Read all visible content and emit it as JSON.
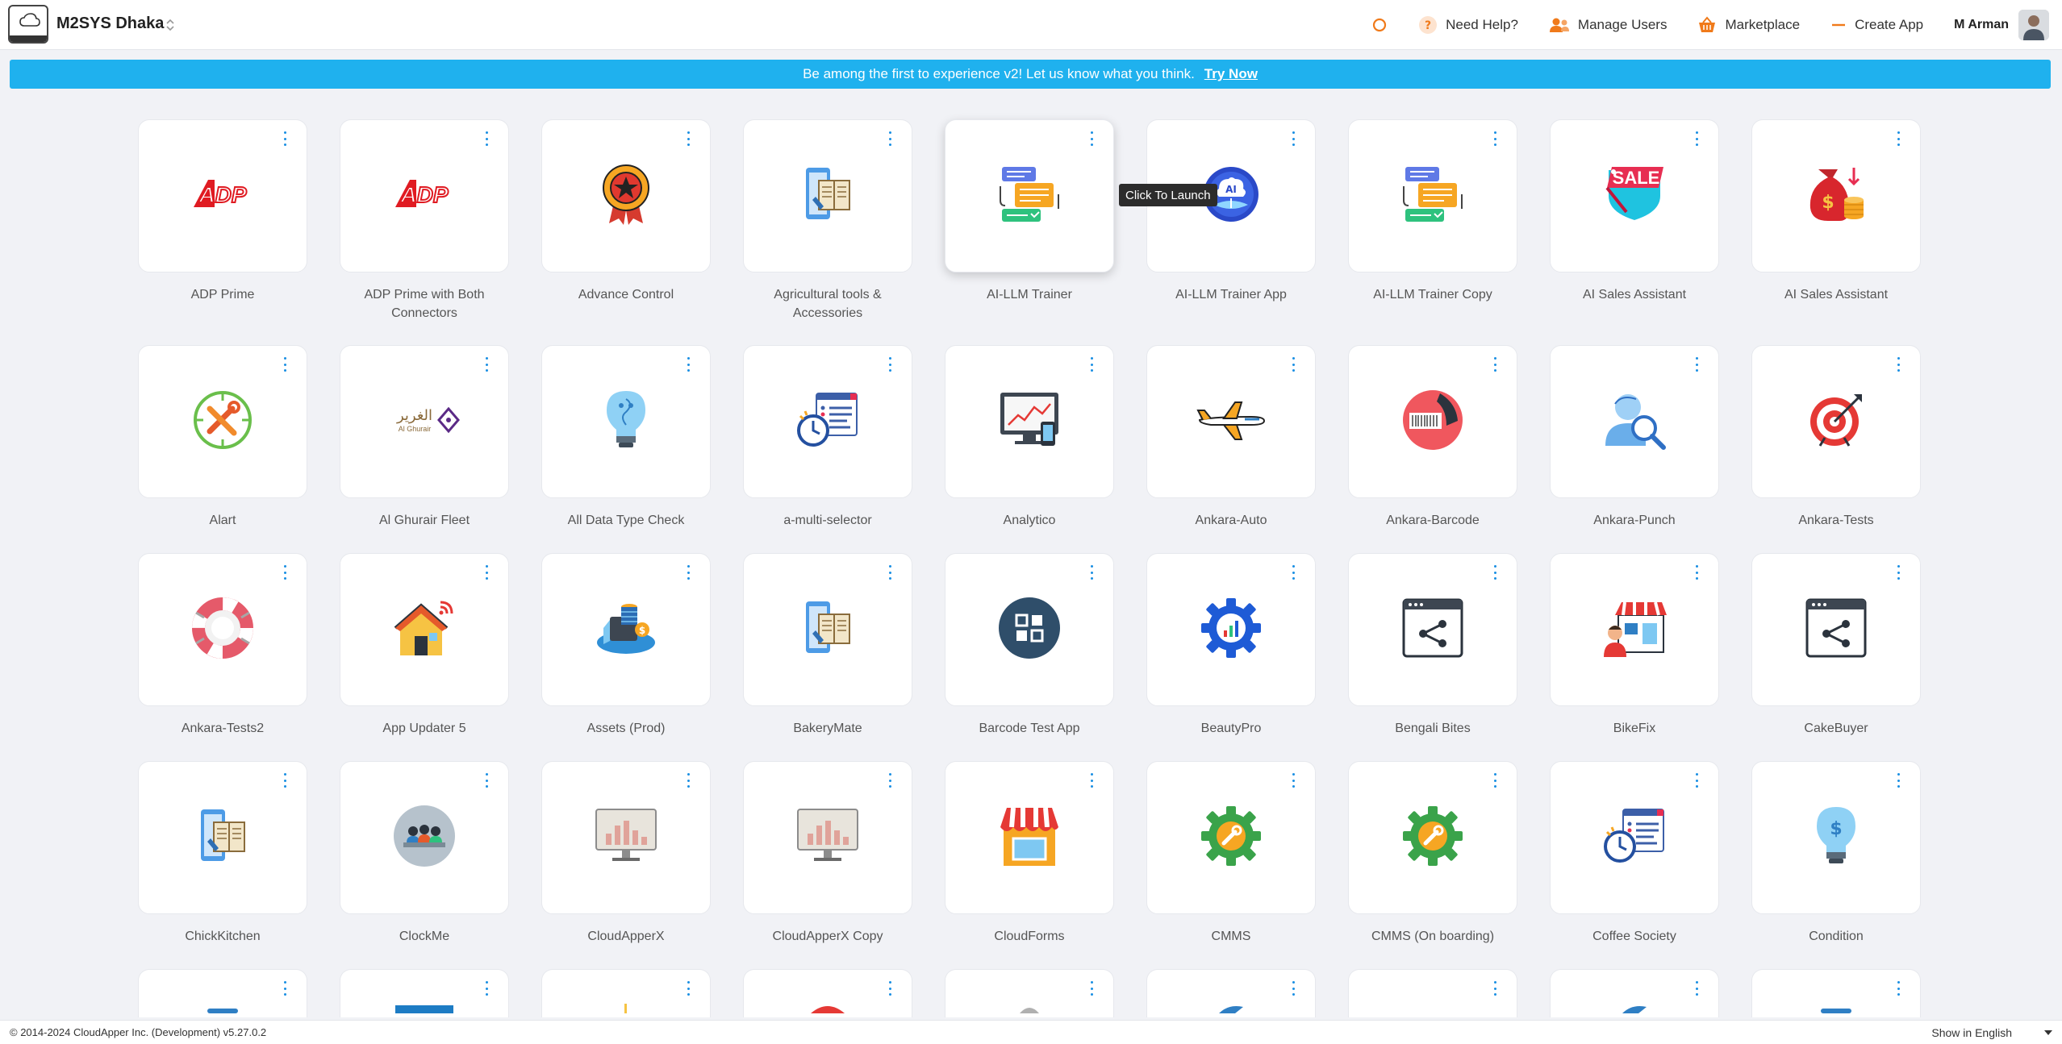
{
  "header": {
    "org_name": "M2SYS Dhaka",
    "help_label": "Need Help?",
    "manage_users_label": "Manage Users",
    "marketplace_label": "Marketplace",
    "create_app_label": "Create App",
    "user_name": "M Arman",
    "accent_color": "#f07a1a"
  },
  "banner": {
    "message": "Be among the first to experience v2! Let us know what you think.",
    "link_label": "Try Now",
    "color": "#1fb1ee"
  },
  "tooltip": "Click To Launch",
  "apps": [
    {
      "label": "ADP Prime",
      "icon": "adp-logo-icon"
    },
    {
      "label": "ADP Prime with Both Connectors",
      "icon": "adp-logo-icon"
    },
    {
      "label": "Advance Control",
      "icon": "award-medal-icon"
    },
    {
      "label": "Agricultural tools & Accessories",
      "icon": "tablet-book-icon"
    },
    {
      "label": "AI-LLM Trainer",
      "icon": "chat-documents-icon"
    },
    {
      "label": "AI-LLM Trainer App",
      "icon": "ai-brain-icon"
    },
    {
      "label": "AI-LLM Trainer Copy",
      "icon": "chat-documents-icon"
    },
    {
      "label": "AI Sales Assistant",
      "icon": "sale-tag-icon"
    },
    {
      "label": "AI Sales Assistant",
      "icon": "money-bag-icon"
    },
    {
      "label": "Alart",
      "icon": "tools-clock-icon"
    },
    {
      "label": "Al Ghurair Fleet",
      "icon": "al-ghurair-logo-icon"
    },
    {
      "label": "All Data Type Check",
      "icon": "lightbulb-icon"
    },
    {
      "label": "a-multi-selector",
      "icon": "schedule-list-icon"
    },
    {
      "label": "Analytico",
      "icon": "monitor-chart-icon"
    },
    {
      "label": "Ankara-Auto",
      "icon": "airplane-icon"
    },
    {
      "label": "Ankara-Barcode",
      "icon": "barcode-icon"
    },
    {
      "label": "Ankara-Punch",
      "icon": "user-search-icon"
    },
    {
      "label": "Ankara-Tests",
      "icon": "target-icon"
    },
    {
      "label": "Ankara-Tests2",
      "icon": "lifebuoy-icon"
    },
    {
      "label": "App Updater 5",
      "icon": "smart-home-icon"
    },
    {
      "label": "Assets (Prod)",
      "icon": "assets-stack-icon"
    },
    {
      "label": "BakeryMate",
      "icon": "tablet-book-icon"
    },
    {
      "label": "Barcode Test App",
      "icon": "grid-app-icon"
    },
    {
      "label": "BeautyPro",
      "icon": "gear-chart-icon"
    },
    {
      "label": "Bengali Bites",
      "icon": "share-window-icon"
    },
    {
      "label": "BikeFix",
      "icon": "shop-worker-icon"
    },
    {
      "label": "CakeBuyer",
      "icon": "share-window-icon"
    },
    {
      "label": "ChickKitchen",
      "icon": "tablet-book-icon"
    },
    {
      "label": "ClockMe",
      "icon": "team-icon"
    },
    {
      "label": "CloudApperX",
      "icon": "monitor-bars-icon"
    },
    {
      "label": "CloudApperX Copy",
      "icon": "monitor-bars-icon"
    },
    {
      "label": "CloudForms",
      "icon": "storefront-icon"
    },
    {
      "label": "CMMS",
      "icon": "gear-wrench-icon"
    },
    {
      "label": "CMMS (On boarding)",
      "icon": "gear-wrench-icon"
    },
    {
      "label": "Coffee Society",
      "icon": "schedule-list-icon"
    },
    {
      "label": "Condition",
      "icon": "lightbulb-dollar-icon"
    }
  ],
  "footer": {
    "copyright": "© 2014-2024 CloudApper Inc. (Development) v5.27.0.2",
    "language": "Show in English"
  }
}
